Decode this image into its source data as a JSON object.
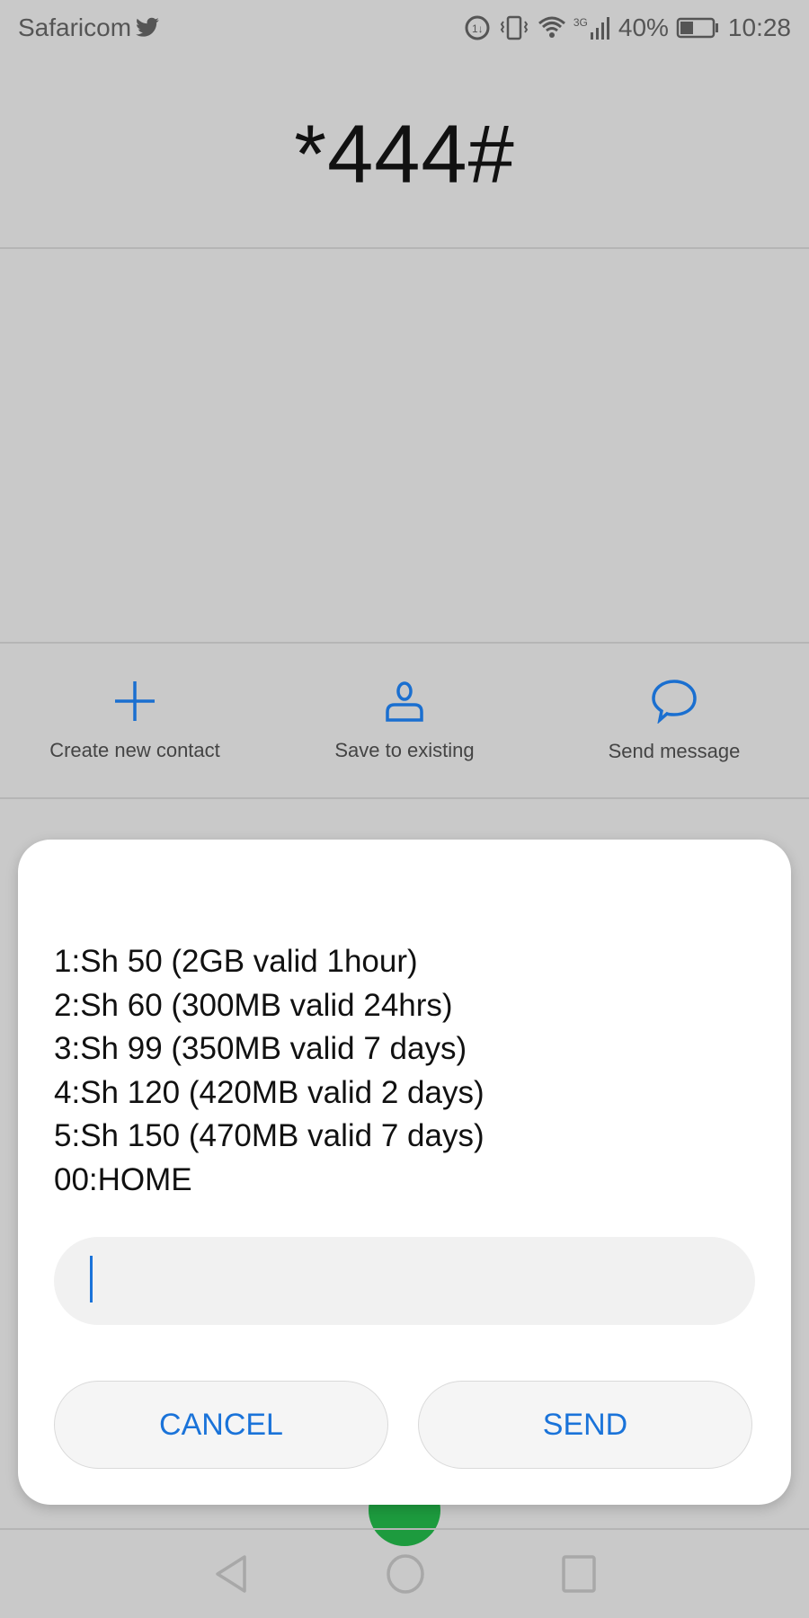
{
  "status_bar": {
    "carrier": "Safaricom",
    "network_type": "3G",
    "battery_percent": "40%",
    "time": "10:28",
    "icons": [
      "twitter-icon",
      "data-saver-icon",
      "vibrate-icon",
      "wifi-icon",
      "signal-icon",
      "battery-icon"
    ]
  },
  "dialer": {
    "number": "*444#"
  },
  "actions": [
    {
      "label": "Create new contact",
      "icon": "plus-icon"
    },
    {
      "label": "Save to existing",
      "icon": "person-icon"
    },
    {
      "label": "Send message",
      "icon": "chat-bubble-icon"
    }
  ],
  "ussd_dialog": {
    "lines": [
      "1:Sh 50 (2GB valid 1hour)",
      "2:Sh 60 (300MB valid 24hrs)",
      "3:Sh 99 (350MB valid 7 days)",
      "4:Sh 120 (420MB valid 2 days)",
      "5:Sh 150 (470MB valid 7 days)",
      "00:HOME"
    ],
    "input_value": "",
    "cancel_label": "CANCEL",
    "send_label": "SEND"
  },
  "colors": {
    "accent": "#1a73d9",
    "backdrop": "#c9c9c9",
    "call_button": "#1d9b3e"
  }
}
